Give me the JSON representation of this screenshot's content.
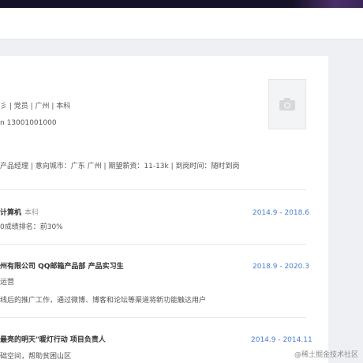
{
  "profile": {
    "line1": "彡   |   党员   |   广州   |   本科",
    "line2": "n    13001001000"
  },
  "intention": {
    "text": "产品经理   |   意向城市：广东 广州   |   期望薪资：11-13k   |   到岗时间：随时到岗"
  },
  "education": {
    "school": "计算机",
    "degree": "本科",
    "detail": "0成绩排名：前30%",
    "period": "2014.9 - 2018.6"
  },
  "work": {
    "title": "州有限公司   QQ邮箱产品部   产品实习生",
    "period": "2018.9 - 2020.3",
    "role": "运营",
    "desc": "线后的推广工作，通过微博、博客和论坛等渠道将新功能触达用户"
  },
  "project": {
    "title": "最亮的明天\"暖灯行动   项目负责人",
    "period": "2014.9 - 2014.11",
    "desc": "础空间，帮助贫困山区"
  },
  "watermark": "@稀土掘金技术社区",
  "colors": {
    "accent": "#4a7fd0",
    "background": "#eef0f4"
  }
}
